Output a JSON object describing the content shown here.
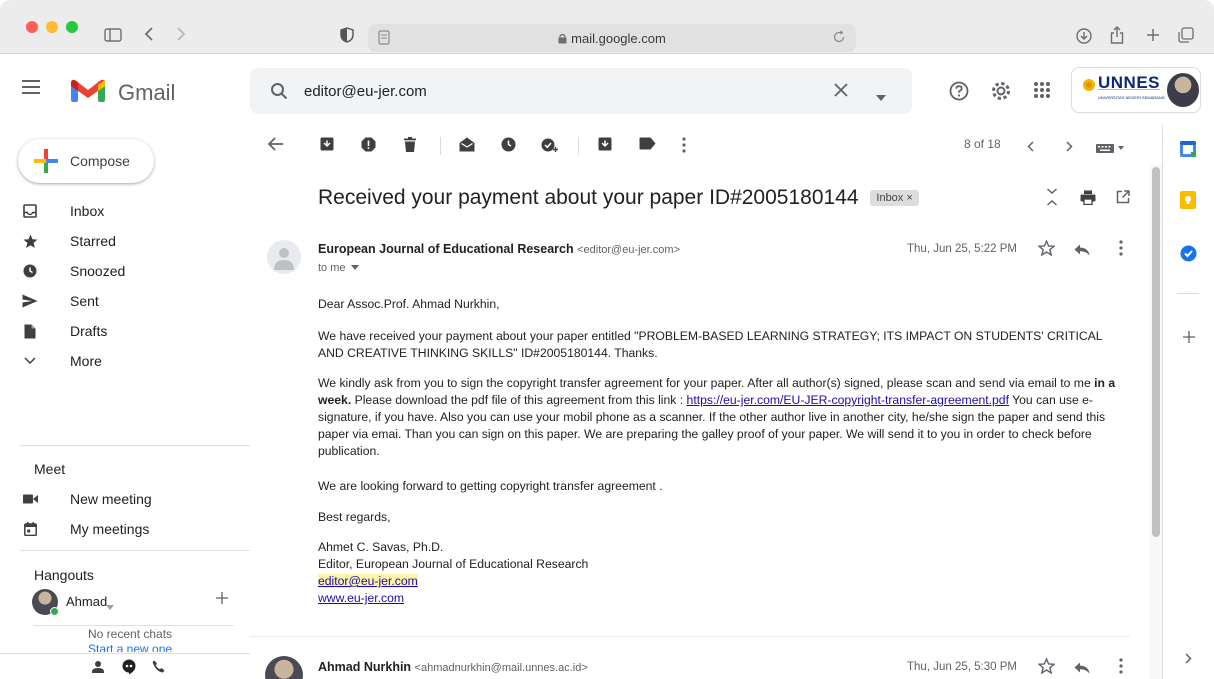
{
  "browser": {
    "url": "mail.google.com"
  },
  "header": {
    "app_name": "Gmail",
    "search_query": "editor@eu-jer.com",
    "org_logo_text": "UNNES",
    "org_logo_subtext": "UNIVERSITAS NEGERI SEMARANG"
  },
  "sidebar": {
    "compose_label": "Compose",
    "items": [
      {
        "label": "Inbox",
        "icon": "inbox-icon"
      },
      {
        "label": "Starred",
        "icon": "star-icon"
      },
      {
        "label": "Snoozed",
        "icon": "clock-icon"
      },
      {
        "label": "Sent",
        "icon": "send-icon"
      },
      {
        "label": "Drafts",
        "icon": "draft-icon"
      },
      {
        "label": "More",
        "icon": "chevron-down-icon"
      }
    ],
    "meet": {
      "title": "Meet",
      "new_meeting": "New meeting",
      "my_meetings": "My meetings"
    },
    "hangouts": {
      "title": "Hangouts",
      "user": "Ahmad",
      "no_recent": "No recent chats",
      "start_new": "Start a new one"
    }
  },
  "toolbar": {
    "pagination": "8 of 18"
  },
  "email": {
    "subject": "Received your payment about your paper ID#2005180144",
    "label_chip": "Inbox",
    "sender_name": "European Journal of Educational Research",
    "sender_email": "<editor@eu-jer.com>",
    "to": "to me",
    "date": "Thu, Jun 25, 5:22 PM",
    "greeting": "Dear Assoc.Prof. Ahmad Nurkhin,",
    "p1": "We have received your payment about your paper entitled \"PROBLEM-BASED LEARNING STRATEGY; ITS IMPACT ON STUDENTS' CRITICAL AND CREATIVE THINKING SKILLS\" ID#2005180144. Thanks.",
    "p2_a": "We kindly ask from you to sign the copyright transfer agreement for your paper. After all author(s) signed, please scan and send via email to me ",
    "p2_bold": "in a week.",
    "p2_b": " Please download the pdf file of this agreement from this link : ",
    "p2_link": "https://eu-jer.com/EU-JER-copyright-transfer-agreement.pdf",
    "p2_c": " You can use e-signature, if you have. Also you can use your mobil phone as a scanner. If the other author live in another city, he/she sign the paper and send this paper via emai. Than you can sign on this paper. We are preparing the galley proof of your paper. We will send it to you in order to check before publication.",
    "p3": "We are looking forward to getting copyright transfer agreement .",
    "closing": "Best regards,",
    "sig_name": "Ahmet C. Savas, Ph.D.",
    "sig_title": "Editor, European Journal of Educational Research",
    "sig_email": "editor@eu-jer.com",
    "sig_web": "www.eu-jer.com"
  },
  "reply_preview": {
    "sender_name": "Ahmad Nurkhin",
    "sender_email": "<ahmadnurkhin@mail.unnes.ac.id>",
    "date": "Thu, Jun 25, 5:30 PM"
  },
  "colors": {
    "gmail_red": "#EA4335",
    "chip_bg": "#dddddd",
    "search_bg": "#f1f3f4",
    "link": "#1a0dab"
  }
}
